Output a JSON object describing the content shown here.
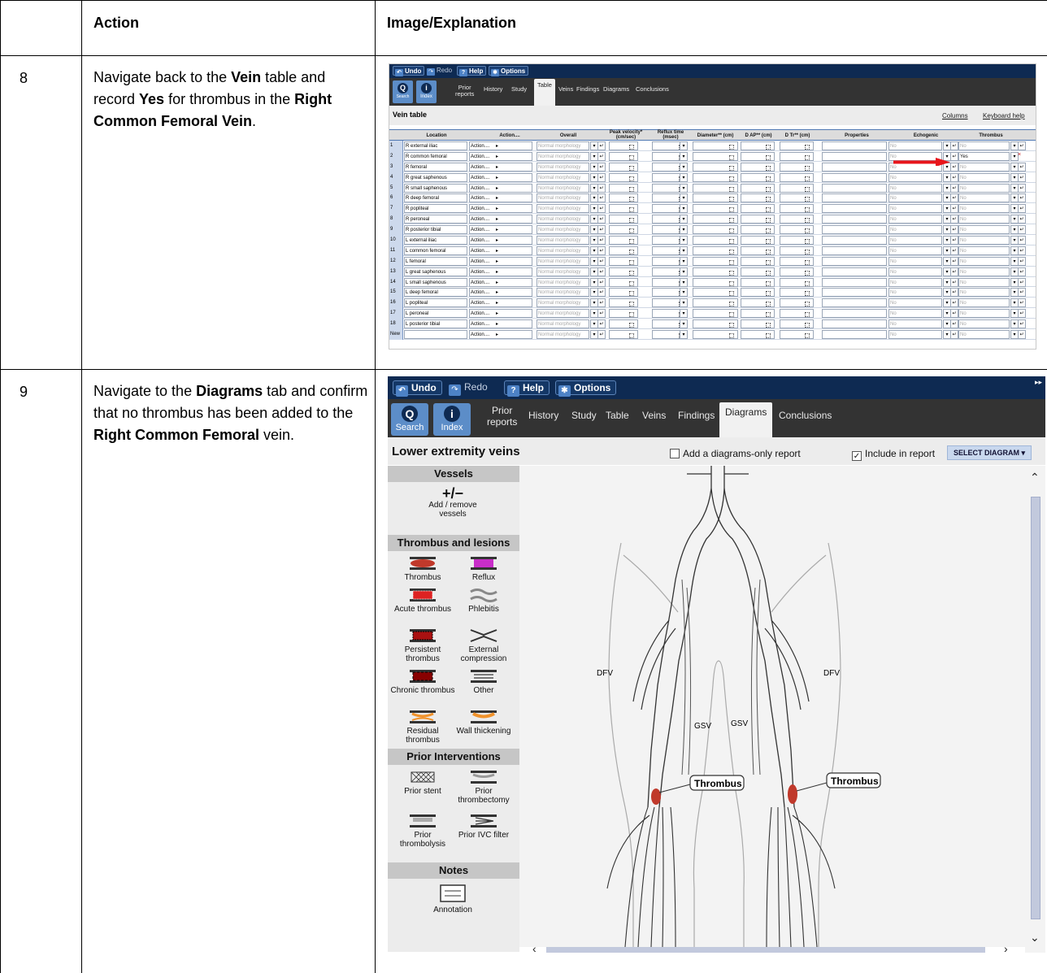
{
  "table": {
    "col1_header": "",
    "col2_header": "Action",
    "col3_header": "Image/Explanation"
  },
  "steps": [
    {
      "number": "8",
      "parts": [
        {
          "t": "Navigate back to the "
        },
        {
          "b": "Vein"
        },
        {
          "t": " table and record "
        },
        {
          "b": "Yes"
        },
        {
          "t": " for thrombus in the "
        },
        {
          "b": "Right Common Femoral Vein"
        },
        {
          "t": "."
        }
      ]
    },
    {
      "number": "9",
      "parts": [
        {
          "t": "Navigate to the "
        },
        {
          "b": "Diagrams"
        },
        {
          "t": " tab and confirm that no thrombus has been added to the "
        },
        {
          "b": "Right Common Femoral"
        },
        {
          "t": " vein."
        }
      ]
    }
  ],
  "toolbar": {
    "undo": "Undo",
    "redo": "Redo",
    "help": "Help",
    "options": "Options"
  },
  "nav": {
    "search": "Search",
    "index": "Index",
    "prior_reports": "Prior reports",
    "prior_line1": "Prior",
    "prior_line2": "reports",
    "tabs": [
      "History",
      "Study",
      "Table",
      "Veins",
      "Findings",
      "Diagrams",
      "Conclusions"
    ]
  },
  "vein_table": {
    "title": "Vein table",
    "links": [
      "Columns",
      "Keyboard help"
    ],
    "columns": [
      "Location",
      "Action....",
      "Overall",
      "Peak velocity* (cm/sec)",
      "Reflux time (msec)",
      "Diameter** (cm)",
      "D AP** (cm)",
      "D Tr** (cm)",
      "Properties",
      "Echogenic",
      "Thrombus"
    ],
    "action_label": "Action....",
    "overall_value": "Normal morphology",
    "echogenic_value": "No",
    "rows": [
      {
        "n": "1",
        "loc": "R external iliac",
        "thrombus": "No"
      },
      {
        "n": "2",
        "loc": "R common femoral",
        "thrombus": "Yes"
      },
      {
        "n": "3",
        "loc": "R femoral",
        "thrombus": "No"
      },
      {
        "n": "4",
        "loc": "R great saphenous",
        "thrombus": "No"
      },
      {
        "n": "5",
        "loc": "R small saphenous",
        "thrombus": "No"
      },
      {
        "n": "6",
        "loc": "R deep femoral",
        "thrombus": "No"
      },
      {
        "n": "7",
        "loc": "R popliteal",
        "thrombus": "No"
      },
      {
        "n": "8",
        "loc": "R peroneal",
        "thrombus": "No"
      },
      {
        "n": "9",
        "loc": "R posterior tibial",
        "thrombus": "No"
      },
      {
        "n": "10",
        "loc": "L external iliac",
        "thrombus": "No"
      },
      {
        "n": "11",
        "loc": "L common femoral",
        "thrombus": "No"
      },
      {
        "n": "12",
        "loc": "L femoral",
        "thrombus": "No"
      },
      {
        "n": "13",
        "loc": "L great saphenous",
        "thrombus": "No"
      },
      {
        "n": "14",
        "loc": "L small saphenous",
        "thrombus": "No"
      },
      {
        "n": "15",
        "loc": "L deep femoral",
        "thrombus": "No"
      },
      {
        "n": "16",
        "loc": "L popliteal",
        "thrombus": "No"
      },
      {
        "n": "17",
        "loc": "L peroneal",
        "thrombus": "No"
      },
      {
        "n": "18",
        "loc": "L posterior tibial",
        "thrombus": "No"
      },
      {
        "n": "New",
        "loc": "",
        "thrombus": "No"
      }
    ],
    "highlight_color": "#e8151b"
  },
  "diagrams": {
    "title": "Lower extremity veins",
    "diagrams_only_label": "Add a diagrams-only report",
    "include_label": "Include in report",
    "select_label": "SELECT DIAGRAM ▾",
    "sections": {
      "vessels": "Vessels",
      "thrombus": "Thrombus and lesions",
      "prior": "Prior Interventions",
      "notes": "Notes"
    },
    "add_remove_symbol": "+/−",
    "add_remove_label": "Add / remove vessels",
    "tools": {
      "thrombus": "Thrombus",
      "reflux": "Reflux",
      "acute": "Acute thrombus",
      "phlebitis": "Phlebitis",
      "persistent": "Persistent thrombus",
      "external": "External compression",
      "chronic": "Chronic thrombus",
      "other": "Other",
      "residual": "Residual thrombus",
      "wall": "Wall thickening",
      "stent": "Prior stent",
      "thrombectomy": "Prior thrombectomy",
      "thrombolysis": "Prior thrombolysis",
      "ivc": "Prior IVC filter",
      "annotation": "Annotation"
    },
    "labels": {
      "dfv_left": "DFV",
      "dfv_right": "DFV",
      "gsv_left": "GSV",
      "gsv_right": "GSV",
      "thrombus_left": "Thrombus",
      "thrombus_right": "Thrombus"
    },
    "thrombus_color": "#c0392b",
    "reflux_color": "#c92ec9",
    "accent_color": "#0e2a52"
  }
}
